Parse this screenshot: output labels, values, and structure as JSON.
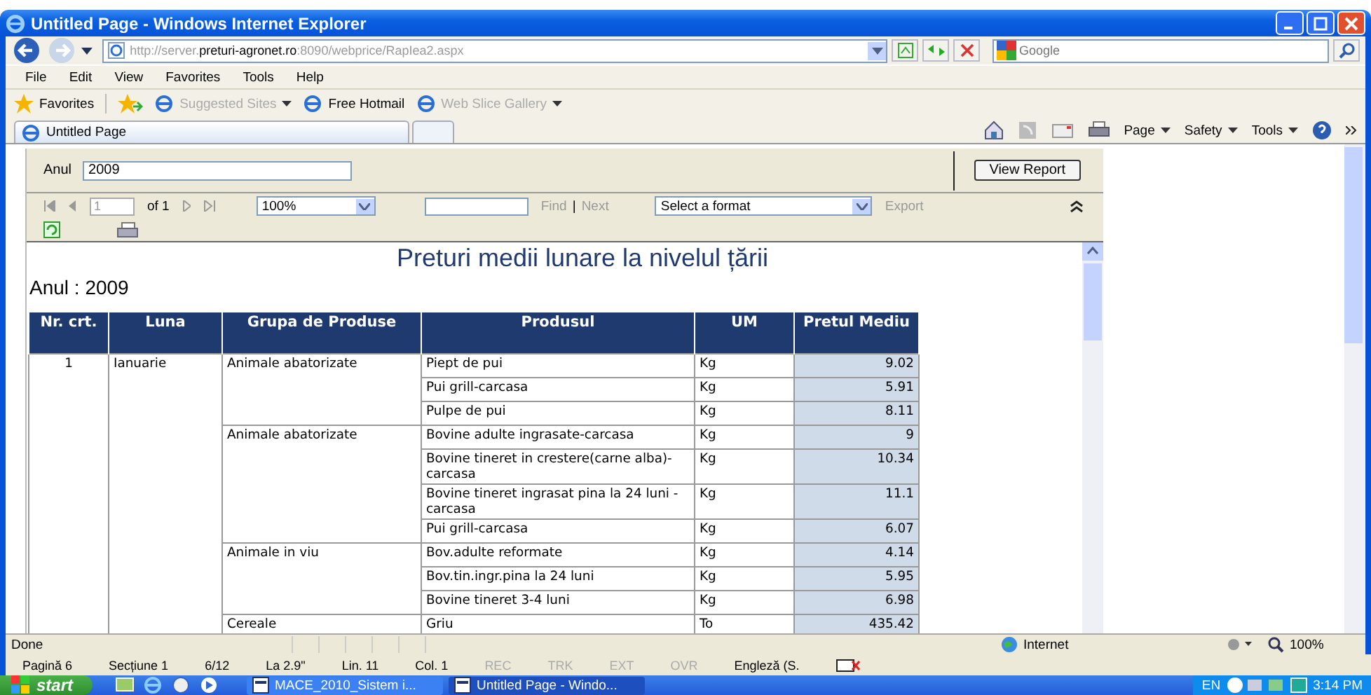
{
  "window": {
    "title": "Untitled Page - Windows Internet Explorer"
  },
  "address_bar": {
    "url_prefix": "http://server.",
    "url_host": "preturi-agronet.ro",
    "url_rest": ":8090/webprice/RapIea2.aspx",
    "search_placeholder": "Google"
  },
  "menu": [
    "File",
    "Edit",
    "View",
    "Favorites",
    "Tools",
    "Help"
  ],
  "favorites_bar": {
    "favorites": "Favorites",
    "links": [
      {
        "label": "Suggested Sites",
        "disabled": true,
        "dropdown": true
      },
      {
        "label": "Free Hotmail",
        "disabled": false,
        "dropdown": false
      },
      {
        "label": "Web Slice Gallery",
        "disabled": true,
        "dropdown": true
      }
    ]
  },
  "tabs": [
    {
      "label": "Untitled Page",
      "selected": true
    }
  ],
  "command_bar": [
    "Page",
    "Safety",
    "Tools"
  ],
  "report_params": {
    "label": "Anul",
    "value": "2009",
    "button": "View Report"
  },
  "report_toolbar": {
    "page": "1",
    "of": "of 1",
    "zoom": "100%",
    "find": "Find",
    "separator": "|",
    "next": "Next",
    "format": "Select a format",
    "export": "Export"
  },
  "report": {
    "title": "Preturi medii lunare la nivelul țării",
    "subtitle": "Anul : 2009",
    "columns": [
      "Nr. crt.",
      "Luna",
      "Grupa de Produse",
      "Produsul",
      "UM",
      "Pretul Mediu"
    ],
    "months": [
      {
        "nr": "1",
        "luna": "Ianuarie",
        "groups": [
          {
            "name": "Animale abatorizate",
            "products": [
              {
                "name": "Piept de pui",
                "um": "Kg",
                "price": "9.02"
              },
              {
                "name": "Pui grill-carcasa",
                "um": "Kg",
                "price": "5.91"
              },
              {
                "name": "Pulpe de pui",
                "um": "Kg",
                "price": "8.11"
              }
            ]
          },
          {
            "name": "Animale abatorizate",
            "products": [
              {
                "name": "Bovine adulte ingrasate-carcasa",
                "um": "Kg",
                "price": "9"
              },
              {
                "name": "Bovine tineret in crestere(carne alba)-carcasa",
                "um": "Kg",
                "price": "10.34"
              },
              {
                "name": "Bovine tineret ingrasat pina la 24 luni - carcasa",
                "um": "Kg",
                "price": "11.1"
              },
              {
                "name": "Pui grill-carcasa",
                "um": "Kg",
                "price": "6.07"
              }
            ]
          },
          {
            "name": "Animale in viu",
            "products": [
              {
                "name": "Bov.adulte reformate",
                "um": "Kg",
                "price": "4.14"
              },
              {
                "name": "Bov.tin.ingr.pina la 24 luni",
                "um": "Kg",
                "price": "5.95"
              },
              {
                "name": "Bovine tineret 3-4 luni",
                "um": "Kg",
                "price": "6.98"
              }
            ]
          },
          {
            "name": "Cereale",
            "products": [
              {
                "name": "Griu",
                "um": "To",
                "price": "435.42"
              }
            ]
          }
        ]
      }
    ]
  },
  "status_bar": {
    "text": "Done",
    "zone": "Internet",
    "zoom": "100%"
  },
  "word_status": [
    {
      "text": "Pagină 6",
      "disabled": false
    },
    {
      "text": "Secțiune 1",
      "disabled": false
    },
    {
      "text": "6/12",
      "disabled": false
    },
    {
      "text": "La 2.9\"",
      "disabled": false
    },
    {
      "text": "Lin. 11",
      "disabled": false
    },
    {
      "text": "Col. 1",
      "disabled": false
    },
    {
      "text": "REC",
      "disabled": true
    },
    {
      "text": "TRK",
      "disabled": true
    },
    {
      "text": "EXT",
      "disabled": true
    },
    {
      "text": "OVR",
      "disabled": true
    },
    {
      "text": "Engleză (S.",
      "disabled": false
    }
  ],
  "taskbar": {
    "start": "start",
    "tasks": [
      {
        "label": "MACE_2010_Sistem i...",
        "selected": false
      },
      {
        "label": "Untitled Page - Windo...",
        "selected": true
      }
    ],
    "language": "EN",
    "clock": "3:14 PM"
  }
}
